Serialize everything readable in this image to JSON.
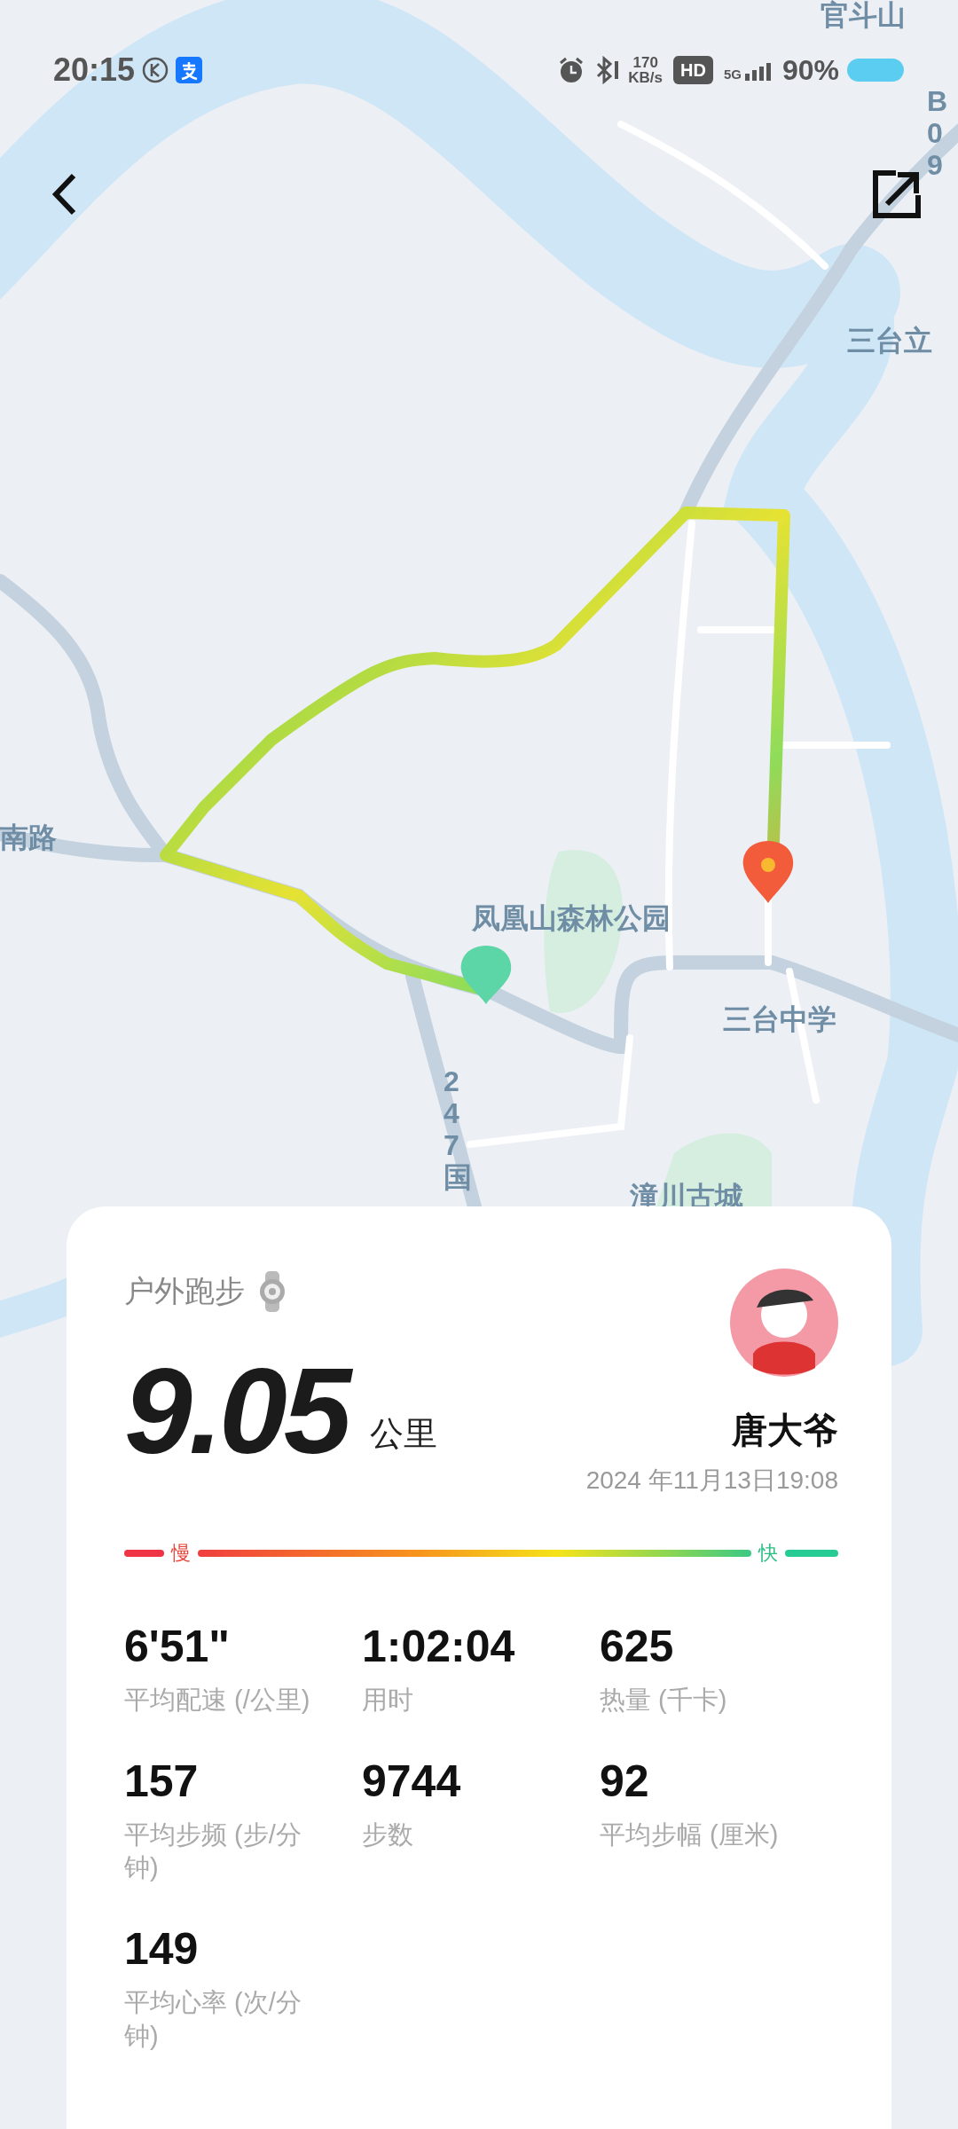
{
  "status_bar": {
    "time": "20:15",
    "net_speed": "170",
    "net_unit": "KB/s",
    "hd": "HD",
    "network": "5G",
    "battery": "90%"
  },
  "map": {
    "labels": [
      "官斗山",
      "B09",
      "三台立",
      "南路",
      "凤凰山森林公园",
      "三台中学",
      "247国",
      "潼川古城"
    ]
  },
  "card": {
    "sport": "户外跑步",
    "distance": "9.05",
    "unit": "公里",
    "user": "唐大爷",
    "datetime": "2024 年11月13日19:08",
    "legend": {
      "slow": "慢",
      "fast": "快"
    },
    "stats": [
      {
        "value": "6'51\"",
        "label": "平均配速 (/公里)"
      },
      {
        "value": "1:02:04",
        "label": "用时"
      },
      {
        "value": "625",
        "label": "热量 (千卡)"
      },
      {
        "value": "157",
        "label": "平均步频 (步/分钟)"
      },
      {
        "value": "9744",
        "label": "步数"
      },
      {
        "value": "92",
        "label": "平均步幅 (厘米)"
      },
      {
        "value": "149",
        "label": "平均心率 (次/分钟)"
      }
    ]
  }
}
